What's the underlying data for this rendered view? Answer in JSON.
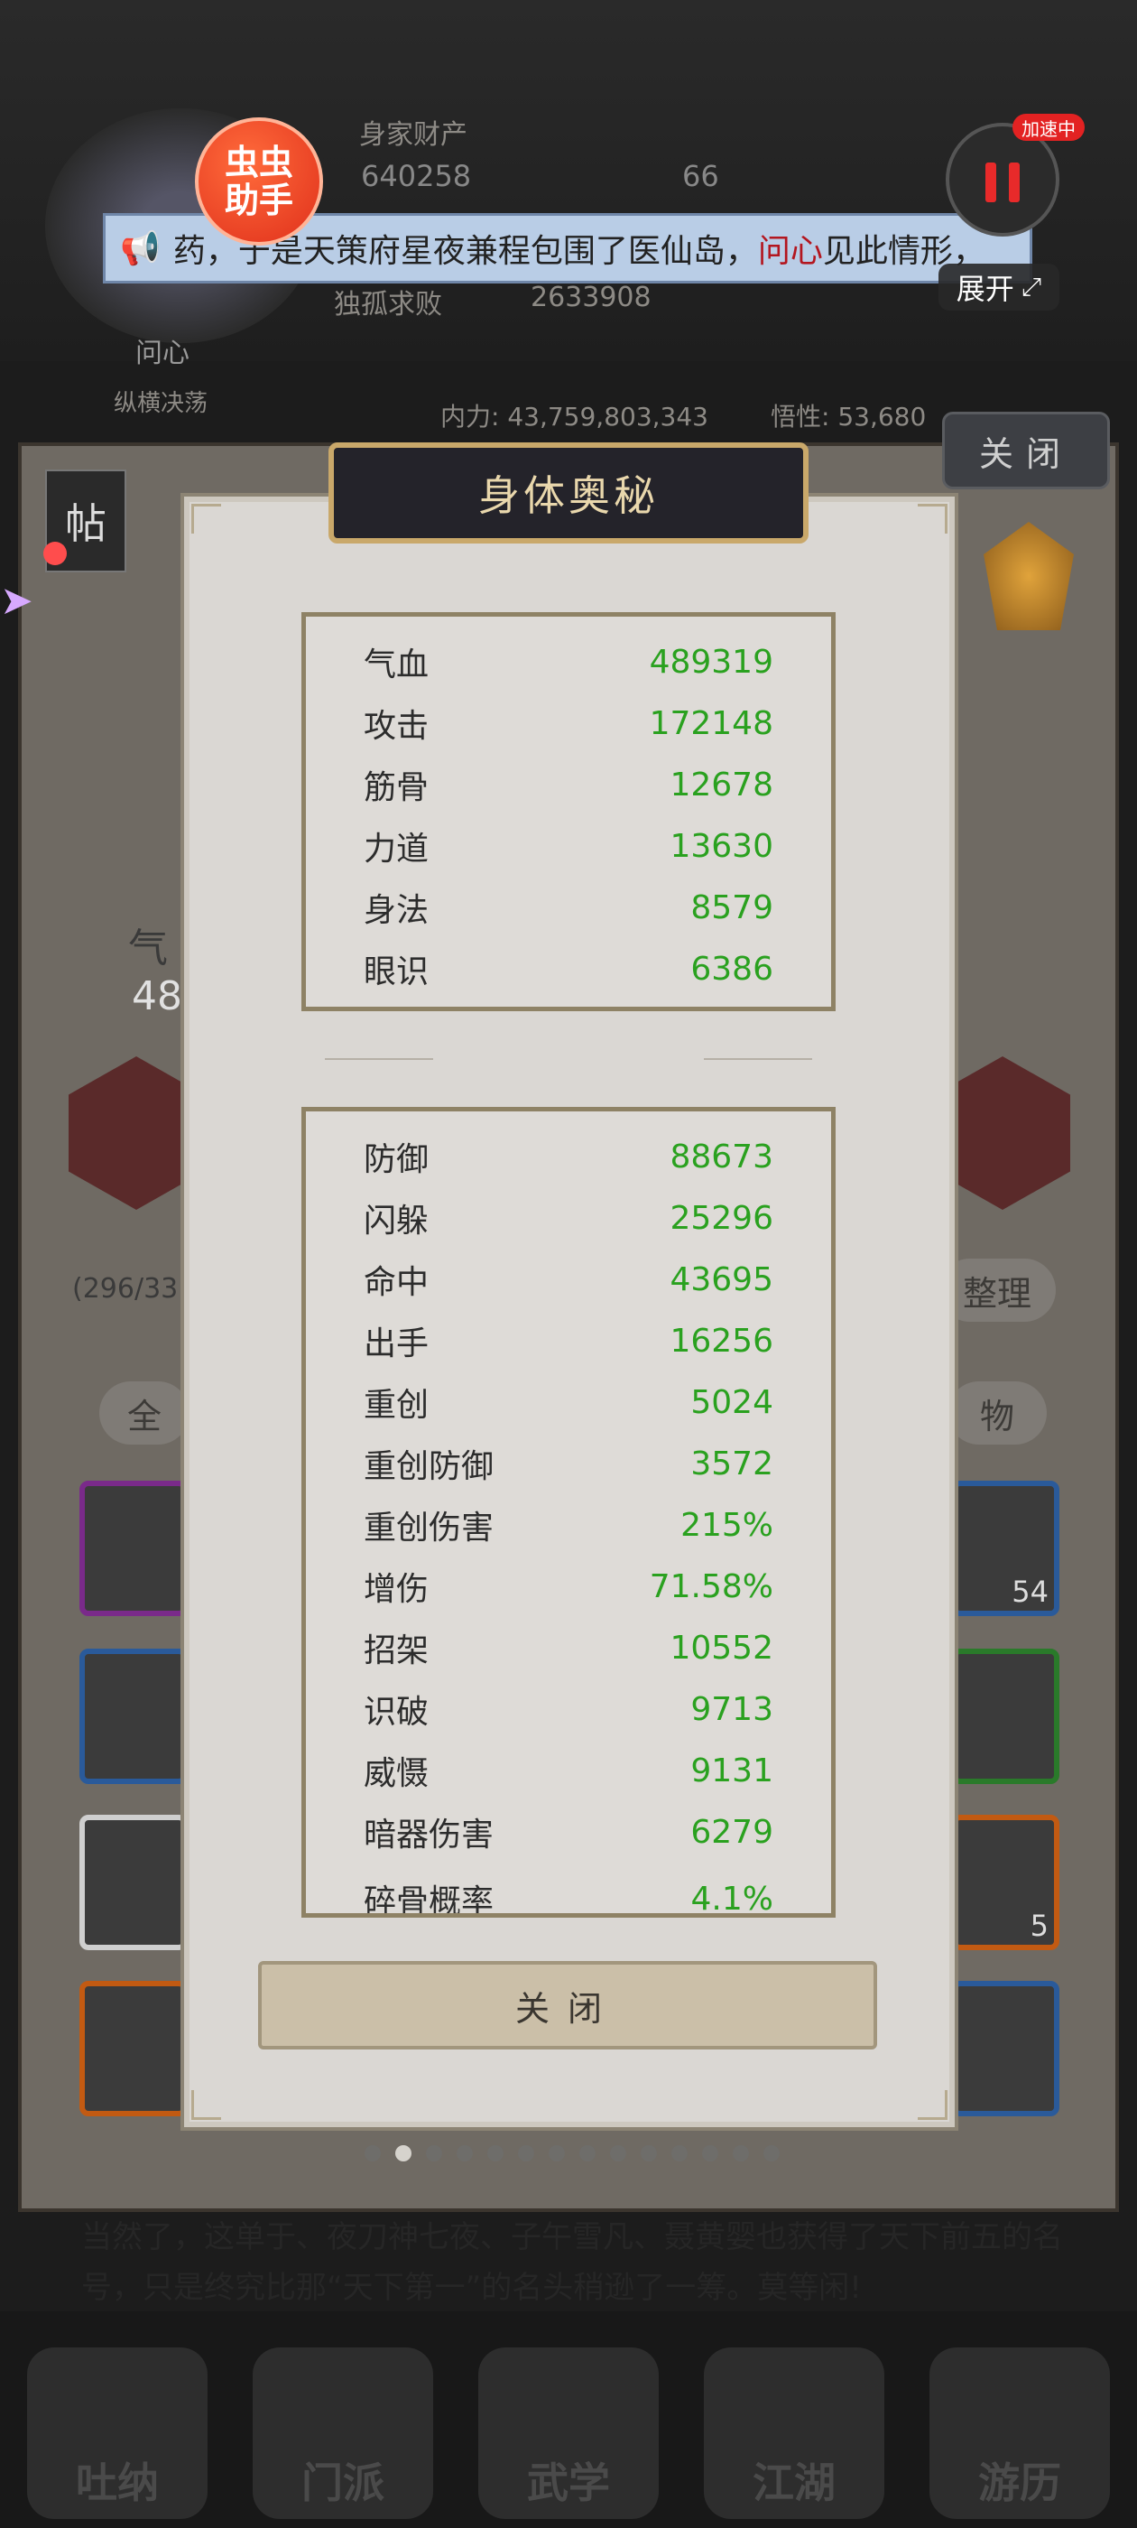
{
  "background": {
    "wealth_label": "身家财产",
    "gold": "640258",
    "jade": "66",
    "title_badge": "独孤求败",
    "title_value": "2633908",
    "name": "问心",
    "tag": "纵横决荡",
    "neili": "内力: 43,759,803,343",
    "wuxing": "悟性: 53,680",
    "left_value": "48",
    "left_label": "气",
    "bag_count": "(296/33",
    "sort_btn": "整理",
    "filter_all": "全",
    "filter_item": "物",
    "slot_count_1": "54",
    "slot_count_2": "5",
    "story_text": "当然了，这单于、夜刀神七夜、子午雪凡、聂黄婴也获得了天下前五的名号，只是终究比那“天下第一”的名头稍逊了一筹。莫等闲!"
  },
  "nav": {
    "items": [
      "吐纳",
      "门派",
      "武学",
      "江湖",
      "游历"
    ]
  },
  "overlay": {
    "helper_label": "虫虫助手",
    "speed_badge": "加速中",
    "expand_label": "展开",
    "ticker_pre": "药，于是天策府星夜兼程包围了医仙岛，",
    "ticker_highlight": "问心",
    "ticker_post": "见此情形，",
    "outer_close": "关闭",
    "tab_label": "帖"
  },
  "modal": {
    "title": "身体奥秘",
    "primary_stats": [
      {
        "label": "气血",
        "value": "489319"
      },
      {
        "label": "攻击",
        "value": "172148"
      },
      {
        "label": "筋骨",
        "value": "12678"
      },
      {
        "label": "力道",
        "value": "13630"
      },
      {
        "label": "身法",
        "value": "8579"
      },
      {
        "label": "眼识",
        "value": "6386"
      }
    ],
    "secondary_stats": [
      {
        "label": "防御",
        "value": "88673"
      },
      {
        "label": "闪躲",
        "value": "25296"
      },
      {
        "label": "命中",
        "value": "43695"
      },
      {
        "label": "出手",
        "value": "16256"
      },
      {
        "label": "重创",
        "value": "5024"
      },
      {
        "label": "重创防御",
        "value": "3572"
      },
      {
        "label": "重创伤害",
        "value": "215%"
      },
      {
        "label": "增伤",
        "value": "71.58%"
      },
      {
        "label": "招架",
        "value": "10552"
      },
      {
        "label": "识破",
        "value": "9713"
      },
      {
        "label": "威慑",
        "value": "9131"
      },
      {
        "label": "暗器伤害",
        "value": "6279"
      },
      {
        "label": "碎骨概率",
        "value": "4.1%"
      }
    ],
    "close_label": "关闭"
  },
  "colors": {
    "stat_value": "#2aa11f",
    "ticker_highlight": "#b3161f",
    "header_bg": "#24232a",
    "header_border": "#c9a86a"
  }
}
